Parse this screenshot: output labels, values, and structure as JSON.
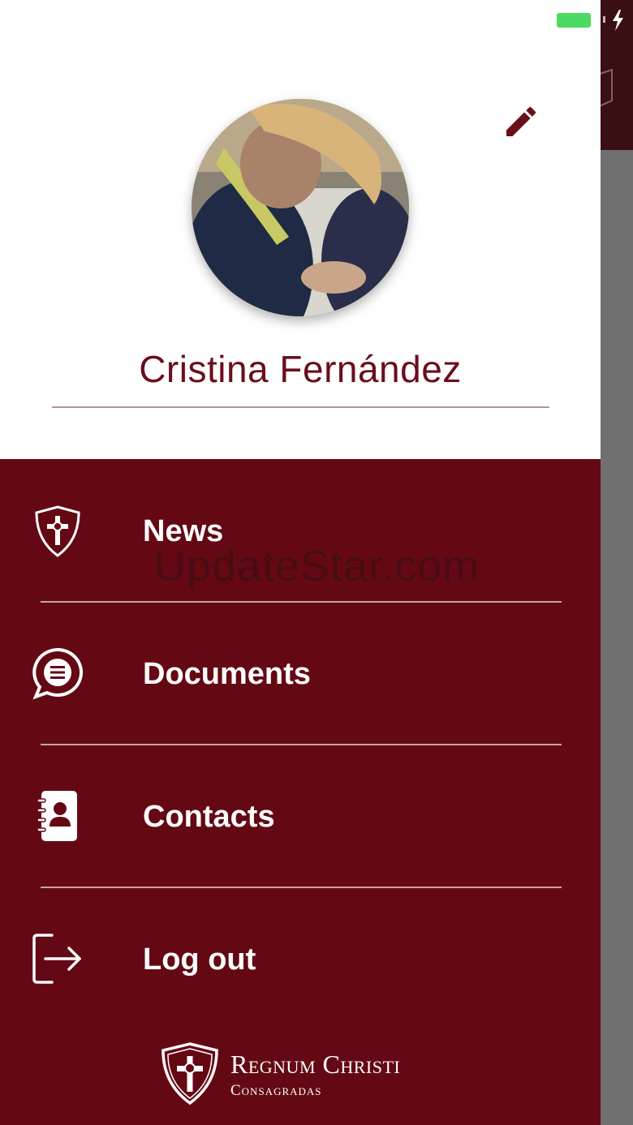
{
  "profile": {
    "name": "Cristina Fernández"
  },
  "menu": {
    "items": [
      {
        "label": "News",
        "icon": "shield-cross-icon"
      },
      {
        "label": "Documents",
        "icon": "chat-bubble-list-icon"
      },
      {
        "label": "Contacts",
        "icon": "contact-book-icon"
      },
      {
        "label": "Log out",
        "icon": "logout-icon"
      }
    ]
  },
  "watermark": "UpdateStar.com",
  "logo": {
    "line1": "Regnum Christi",
    "line2": "Consagradas"
  },
  "colors": {
    "brand": "#640914",
    "name_text": "#6a0e1c",
    "battery": "#4cd964"
  }
}
